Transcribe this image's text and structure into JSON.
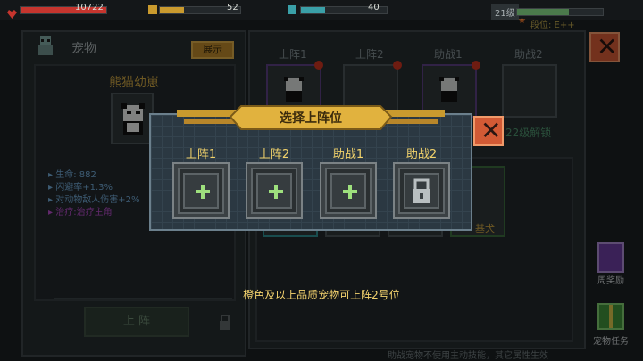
{
  "topbar": {
    "hp": "10722",
    "energy": "52",
    "exp": "40",
    "level": "21级",
    "rank": "段位: E++"
  },
  "pet_panel": {
    "title": "宠物",
    "show_button": "展示",
    "pet_name": "熊猫幼崽",
    "stats": [
      {
        "text": "生命: 882",
        "color": "#6fa6d2"
      },
      {
        "text": "闪避率+1.3%",
        "color": "#6fa6d2"
      },
      {
        "text": "对动物敌人伤害+2%",
        "color": "#6fa6d2"
      },
      {
        "text": "治疗:治疗主角",
        "color": "#b24bc7"
      }
    ],
    "deploy_button": "上 阵"
  },
  "formation": {
    "slots": [
      "上阵1",
      "上阵2",
      "助战1",
      "助战2"
    ],
    "unlock_text": "22级解锁",
    "pet_list_label": "基犬"
  },
  "modal": {
    "title": "选择上阵位",
    "slots": [
      {
        "label": "上阵1",
        "icon": "plus-icon"
      },
      {
        "label": "上阵2",
        "icon": "plus-icon"
      },
      {
        "label": "助战1",
        "icon": "plus-icon"
      },
      {
        "label": "助战2",
        "icon": "lock-icon"
      }
    ],
    "hint": "橙色及以上品质宠物可上阵2号位"
  },
  "side": {
    "weekly_reward": "周奖励",
    "pet_task": "宠物任务"
  },
  "footer_note": "助战宠物不使用主动技能，其它属性生效",
  "colors": {
    "hp": "#c6352e",
    "energy": "#c99a2e",
    "exp": "#3aa0a8",
    "accent": "#f1d26b",
    "plus": "#9ee07d",
    "close": "#d25a35"
  }
}
